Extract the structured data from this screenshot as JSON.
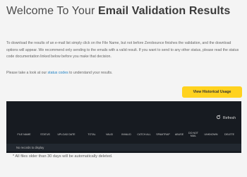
{
  "header": {
    "title_prefix": "Welcome To Your ",
    "title_bold": "Email Validation Results"
  },
  "intro": {
    "paragraph": "To download the results of an e-mail list simply click on the File Name, but not before Zerobounce finishes the validation, and the download options will appear. We recommend only sending to the emails with a valid result. If you want to send to any other status, please read the status code documentation linked below before you make that decision.",
    "status_prefix": "Please take a look at our ",
    "status_link": "status codes",
    "status_suffix": " to understand your results."
  },
  "actions": {
    "history_button": "View Historical Usage",
    "refresh_label": "Refresh",
    "refresh_icon": "refresh-icon"
  },
  "table": {
    "columns": [
      "FILE NAME",
      "STATUS",
      "UPLOAD DATE",
      "TOTAL",
      "VALID",
      "INVALID",
      "CATCH ALL",
      "SPAMTRAP",
      "ABUSE",
      "DO NOT MAIL",
      "UNKNOWN",
      "DELETE"
    ],
    "empty_message": "No records to display"
  },
  "footer": {
    "note": "* All files older than 30 days will be automatically deleted."
  },
  "colors": {
    "accent": "#ffd21f",
    "link": "#1e7fc1",
    "panel": "#171b21"
  }
}
